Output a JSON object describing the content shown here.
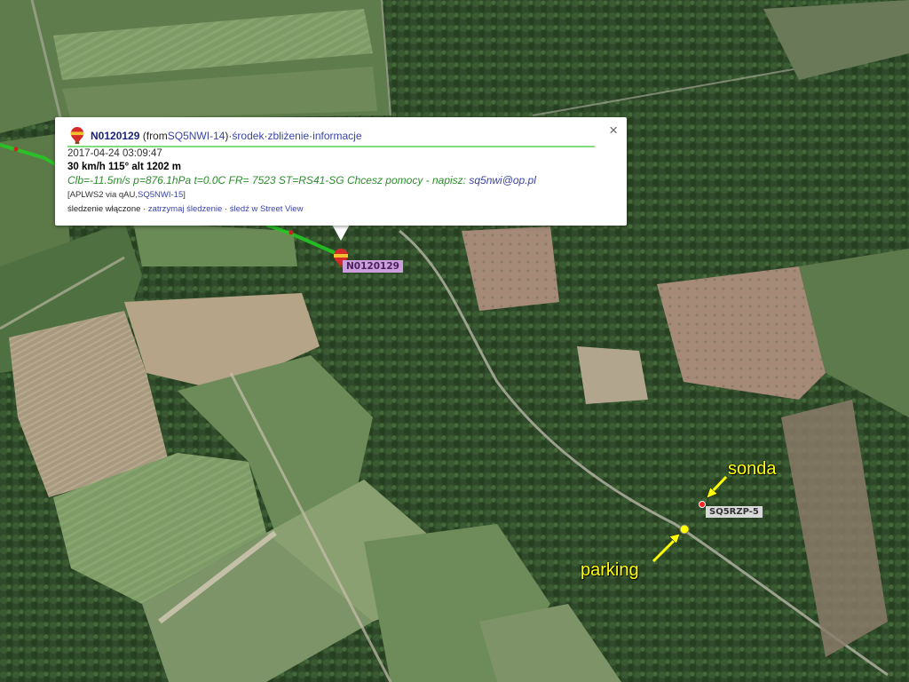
{
  "popup": {
    "callsign": "N0120129",
    "from_prefix": "(from ",
    "from_station": "SQ5NWI-14",
    "from_suffix": ")",
    "sep": " · ",
    "link_center": "środek",
    "link_zoom": "zbliżenie",
    "link_info": "informacje",
    "timestamp": "2017-04-24 03:09:47",
    "speed_line": "30 km/h 115° alt 1202 m",
    "comment_prefix": "Clb=-11.5m/s p=876.1hPa t=0.0C FR= 7523 ST=RS41-SG Chcesz pomocy - napisz: ",
    "comment_email": "sq5nwi@op.pl",
    "path_prefix": "[APLWS2 via qAU,",
    "path_station": "SQ5NWI-15",
    "path_suffix": "]",
    "tracking_text": "śledzenie włączone",
    "link_stop_tracking": "zatrzymaj śledzenie",
    "link_streetview": "śledź w Street View",
    "close_glyph": "×"
  },
  "map": {
    "object_label": "N0120129",
    "station_label": "SQ5RZP-5",
    "annotation_sonda": "sonda",
    "annotation_parking": "parking",
    "colors": {
      "track": "#22cc22",
      "sonde_dot": "#ff2020",
      "parking_dot": "#ffff00",
      "annotation": "#ffff00"
    },
    "icons": {
      "balloon": "hot-air-balloon-icon",
      "close": "close-icon"
    }
  }
}
